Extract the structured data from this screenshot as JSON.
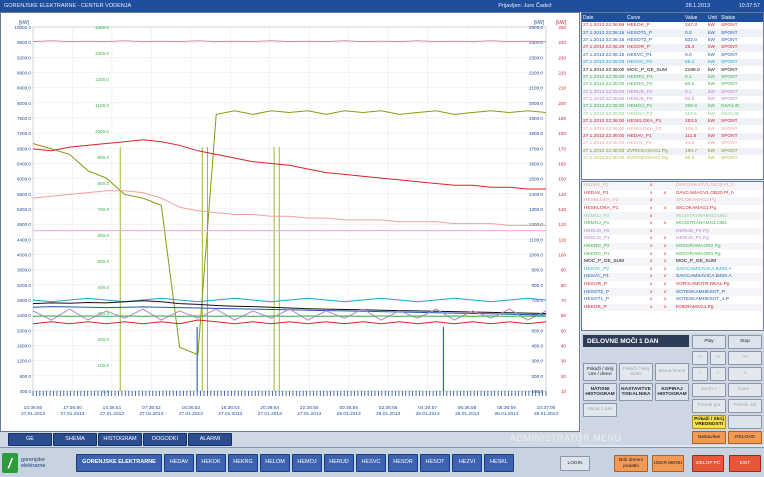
{
  "titlebar": {
    "app": "GORENJSKE ELEKTRARNE - CENTER VODENJA",
    "user": "Prijavljen: Jure Čadež",
    "date": "28.1.2013",
    "time": "10:37:57"
  },
  "chart_data": {
    "type": "line",
    "left_axis_unit": "[kW]",
    "right_axis_units": [
      "[kW]",
      "[kW]"
    ],
    "left_axis_ticks": [
      "10000.0",
      "9600.0",
      "9200.0",
      "8800.0",
      "8400.0",
      "8000.0",
      "7600.0",
      "7200.0",
      "6800.0",
      "6400.0",
      "6000.0",
      "5600.0",
      "5200.0",
      "4800.0",
      "4400.0",
      "4000.0",
      "3600.0",
      "3200.0",
      "2800.0",
      "2400.0",
      "2000.0",
      "1600.0",
      "1200.0",
      "800.0",
      "400.0"
    ],
    "inner_axis_ticks": [
      "1400.0",
      "1300.0",
      "1200.0",
      "1100.0",
      "1000.0",
      "900.0",
      "800.0",
      "700.0",
      "600.0",
      "500.0",
      "400.0",
      "300.0",
      "200.0",
      "100.0",
      "0.0"
    ],
    "right_axis_ticks": [
      "2500.0",
      "2400.0",
      "2300.0",
      "2200.0",
      "2100.0",
      "2000.0",
      "1900.0",
      "1800.0",
      "1700.0",
      "1600.0",
      "1500.0",
      "1400.0",
      "1300.0",
      "1200.0",
      "1100.0",
      "1000.0",
      "900.0",
      "800.0",
      "700.0",
      "600.0",
      "500.0",
      "400.0",
      "300.0",
      "200.0",
      "100.0"
    ],
    "right_inner_ticks": [
      "250",
      "240",
      "230",
      "220",
      "210",
      "200",
      "190",
      "180",
      "170",
      "160",
      "150",
      "140",
      "130",
      "120",
      "110",
      "100",
      "90",
      "80",
      "70",
      "60",
      "50",
      "40",
      "30",
      "20",
      "10"
    ],
    "x_labels": [
      {
        "time": "10:36:50",
        "date": "27.01.2013"
      },
      {
        "time": "17:36:50",
        "date": "27.01.2013"
      },
      {
        "time": "14:36:51",
        "date": "27.01.2013"
      },
      {
        "time": "07:36:52",
        "date": "27.01.2013"
      },
      {
        "time": "18:36:52",
        "date": "27.01.2013"
      },
      {
        "time": "16:36:53",
        "date": "27.01.2013"
      },
      {
        "time": "20:36:54",
        "date": "27.01.2013"
      },
      {
        "time": "22:35:55",
        "date": "27.01.2013"
      },
      {
        "time": "00:36:55",
        "date": "28.01.2013"
      },
      {
        "time": "02:36:56",
        "date": "28.01.2013"
      },
      {
        "time": "04:36:57",
        "date": "28.01.2013"
      },
      {
        "time": "06:36:58",
        "date": "28.01.2013"
      },
      {
        "time": "08:36:59",
        "date": "28.01.2013"
      },
      {
        "time": "10:37:00",
        "date": "28.01.2013"
      }
    ],
    "series": [
      {
        "color": "#8a9a12",
        "values": [
          6800,
          6650,
          6500,
          6050,
          5850,
          5400,
          5300,
          5100,
          1200,
          1000,
          7600,
          7700,
          7600,
          7700,
          7650,
          7700,
          7600,
          7700,
          7650,
          7700,
          7600,
          7650,
          7700,
          7600,
          7650,
          7700,
          7650,
          7700,
          7650
        ]
      },
      {
        "color": "#d8232a",
        "values": [
          6650,
          6600,
          6700,
          6750,
          6800,
          6850,
          6900,
          6850,
          6750,
          6600,
          6500,
          6400,
          6300,
          6250,
          6200,
          6100,
          6000,
          5950,
          5900,
          5850,
          5800,
          5750,
          5700,
          5650,
          5650,
          5600,
          5600,
          5550,
          5550
        ]
      },
      {
        "color": "#f0a0a0",
        "values": [
          5300,
          5350,
          5400,
          5450,
          5500,
          5500,
          5450,
          5300,
          5050,
          4950,
          4900,
          4850,
          4850,
          4800,
          4800,
          4750,
          4750,
          4700,
          4700,
          4700,
          4650,
          4650,
          4650,
          4600,
          4600,
          4600,
          4550,
          4550,
          4550
        ]
      },
      {
        "color": "#d8232a",
        "values": [
          1850,
          1900,
          1850,
          1900,
          1850,
          1900,
          1850,
          1900,
          1850,
          1950,
          1900,
          1850,
          1900,
          1850,
          1900,
          1850,
          1900,
          1850,
          1900,
          1850,
          1900,
          1850,
          1900,
          1850,
          1900,
          1850,
          1900,
          1850,
          1900
        ]
      },
      {
        "color": "#1aa8d8",
        "values": [
          2500,
          2450,
          2500,
          2550,
          2500,
          2450,
          2500,
          2550,
          2500,
          2450,
          2500,
          2550,
          2500,
          2450,
          2500,
          2550,
          2500,
          2450,
          2500,
          2550,
          2500,
          2450,
          2500,
          2550,
          2500,
          2450,
          2500,
          2550,
          2500
        ]
      },
      {
        "color": "#111111",
        "values": [
          2400,
          2420,
          2410,
          2430,
          2420,
          2450,
          2480,
          2450,
          2400,
          2380,
          2350,
          2330,
          2320,
          2300,
          2280,
          2260,
          2250,
          2240,
          2230,
          2220,
          2210,
          2200,
          2190,
          2180,
          2170,
          2160,
          2150,
          2140,
          2130
        ]
      },
      {
        "color": "#1e5ab4",
        "values": [
          2300,
          2320,
          2310,
          2300,
          2290,
          2300,
          2310,
          2300,
          2290,
          2280,
          2270,
          2260,
          2250,
          2240,
          2230,
          2220,
          2210,
          2200,
          2190,
          2180,
          2170,
          2160,
          2150,
          2140,
          2130,
          2120,
          2110,
          2100,
          2090
        ]
      },
      {
        "color": "#c080d0",
        "values": [
          2200,
          1950,
          2250,
          1950,
          2200,
          2000,
          2250,
          1950,
          2200,
          2000,
          2250,
          1950,
          2200,
          2000,
          2250,
          1950,
          2200,
          2000,
          2250,
          1950,
          2200,
          2000,
          2250,
          1950,
          2200,
          2000,
          2250,
          1950,
          2200
        ]
      },
      {
        "color": "#3ab34a",
        "values": [
          2050,
          2060,
          2050,
          2060,
          2050,
          2060,
          2050,
          2060,
          2050,
          2060,
          2050,
          2060,
          2050,
          2060,
          2050,
          2060,
          2050,
          2060,
          2050,
          2060,
          2050,
          2060,
          2050,
          2060,
          2050,
          2060,
          2050,
          2060,
          2050
        ]
      },
      {
        "color": "#d090a0",
        "values": [
          9600,
          9620,
          9600,
          9610,
          9600,
          9620,
          9600,
          9610,
          9600,
          9620,
          9600,
          9610,
          9600,
          9620,
          9600,
          9610,
          9600,
          9620,
          9600,
          9610,
          9600,
          9620,
          9600,
          9610,
          9600,
          9620,
          9600,
          9610,
          9600
        ]
      },
      {
        "color": "#f4a6d8",
        "values": [
          4400,
          4410,
          4400,
          4410,
          4400,
          4410,
          4400,
          4410,
          4400,
          4410,
          4400,
          4410,
          4400,
          4410,
          4400,
          4410,
          4400,
          4410,
          4400,
          4410,
          4400,
          4410,
          4400,
          4410,
          4400,
          4410,
          4400,
          4410,
          4400
        ]
      }
    ],
    "ylim": [
      0,
      10000
    ]
  },
  "cursor_table": {
    "headers": [
      "Date",
      "Curve",
      "Value",
      "Unit",
      "Status"
    ],
    "rows": [
      {
        "date": "27.1.2013 22:36:59",
        "curve": "HEKOK_P",
        "value": "247.3",
        "unit": "kW",
        "status": "SPONT",
        "color": "#d8232a"
      },
      {
        "date": "27.1.2013 22:36:15",
        "curve": "HESOT1_P",
        "value": "0.0",
        "unit": "kW",
        "status": "SPONT",
        "color": "#1e5ab4"
      },
      {
        "date": "27.1.2013 22:36:15",
        "curve": "HESOT2_P",
        "value": "832.0",
        "unit": "kW",
        "status": "SPONT",
        "color": "#1e5ab4"
      },
      {
        "date": "27.1.2013 22:36:29",
        "curve": "HESOR_P",
        "value": "26.3",
        "unit": "kW",
        "status": "SPONT",
        "color": "#d8232a"
      },
      {
        "date": "27.1.2013 22:36:16",
        "curve": "HESVC_P1",
        "value": "0.0",
        "unit": "kW",
        "status": "SPONT",
        "color": "#1e5ab4"
      },
      {
        "date": "27.1.2013 22:36:03",
        "curve": "HESVC_P2",
        "value": "65.1",
        "unit": "kW",
        "status": "SPONT",
        "color": "#1aa8d8"
      },
      {
        "date": "27.1.2013 22:36:00",
        "curve": "MOC_P_GE_SUM",
        "value": "2198.0",
        "unit": "kW",
        "status": "SPONT",
        "color": "#111111"
      },
      {
        "date": "27.1.2013 22:36:00",
        "curve": "HEKRG_P1",
        "value": "0.1",
        "unit": "kW",
        "status": "SPONT",
        "color": "#3ab34a"
      },
      {
        "date": "27.1.2013 22:36:00",
        "curve": "HEKRG_P2",
        "value": "83.2",
        "unit": "kW",
        "status": "SPONT",
        "color": "#3ab34a"
      },
      {
        "date": "27.1.2013 22:36:00",
        "curve": "HERUD_P1",
        "value": "0.1",
        "unit": "kW",
        "status": "SPONT",
        "color": "#c080d0"
      },
      {
        "date": "27.1.2013 22:36:00",
        "curve": "HERUD_P2",
        "value": "82.5",
        "unit": "kW",
        "status": "SPONT",
        "color": "#c080d0"
      },
      {
        "date": "27.1.2013 22:36:00",
        "curve": "HEMOJ_P1",
        "value": "209.6",
        "unit": "kW",
        "status": "INVALID",
        "color": "#3ab34a"
      },
      {
        "date": "27.1.2013 22:36:00",
        "curve": "HEMOJ_P2",
        "value": "119.6",
        "unit": "kW",
        "status": "INVALID",
        "color": "#8ed08e"
      },
      {
        "date": "27.1.2013 22:36:00",
        "curve": "HESKLOKA_P1",
        "value": "193.5",
        "unit": "kW",
        "status": "SPONT",
        "color": "#d8232a"
      },
      {
        "date": "27.1.2013 22:36:00",
        "curve": "HESKLOKA_P2",
        "value": "105.3",
        "unit": "kW",
        "status": "SPONT",
        "color": "#f0a0a0"
      },
      {
        "date": "27.1.2013 22:36:00",
        "curve": "HEDAV_P1",
        "value": "111.5",
        "unit": "kW",
        "status": "SPONT",
        "color": "#d8232a"
      },
      {
        "date": "27.1.2013 22:36:00",
        "curve": "HEDAV_P2",
        "value": "43.6",
        "unit": "kW",
        "status": "SPONT",
        "color": "#f0a0a0"
      },
      {
        "date": "27.1.2013 22:36:00",
        "curve": "ZVIRCEVSAG1.Pg",
        "value": "190.7",
        "unit": "kW",
        "status": "SPONT",
        "color": "#8a9a12"
      },
      {
        "date": "27.1.2013 22:36:00",
        "curve": "ZVIRCEVSAG1.Pg",
        "value": "86.9",
        "unit": "kW",
        "status": "SPONT",
        "color": "#b8c040"
      }
    ]
  },
  "signal_list": [
    {
      "name": "HEDAV_P2",
      "m1": "x",
      "m2": "",
      "tag": "DAVCAMAGV1.OB20.Pf_h",
      "color": "#f0a0a0"
    },
    {
      "name": "HEDAV_P1",
      "m1": "x",
      "m2": "x",
      "tag": "DAVCAMAGV1.OB20.Pf_h",
      "color": "#d8232a"
    },
    {
      "name": "HESKLOKA_P2",
      "m1": "x",
      "m2": "",
      "tag": "SKLOKAMAG2.Pg",
      "color": "#f0a0a0"
    },
    {
      "name": "HESKLOKA_P1",
      "m1": "x",
      "m2": "x",
      "tag": "SKLOKAMAG1.Pg",
      "color": "#d8232a"
    },
    {
      "name": "HEMOJ_P2",
      "m1": "x",
      "m2": "",
      "tag": "MOJSTRANAMG2.OB2",
      "color": "#8ed08e"
    },
    {
      "name": "HEMOJ_P1",
      "m1": "x",
      "m2": "x",
      "tag": "MOJSTRANAMG1.OB2",
      "color": "#3ab34a"
    },
    {
      "name": "HERUD_P2",
      "m1": "x",
      "m2": "",
      "tag": "HERUD_P2.Pg",
      "color": "#c080d0"
    },
    {
      "name": "HERUD_P1",
      "m1": "x",
      "m2": "x",
      "tag": "HERUD_P1.Pg",
      "color": "#c080d0"
    },
    {
      "name": "HEKRG_P2",
      "m1": "x",
      "m2": "x",
      "tag": "KRSGRAMAGR2.Pg",
      "color": "#3ab34a"
    },
    {
      "name": "HEKRG_P1",
      "m1": "x",
      "m2": "x",
      "tag": "KRSGRAMAGR1.Pg",
      "color": "#3ab34a"
    },
    {
      "name": "MOC_P_GE_SUM",
      "m1": "x",
      "m2": "x",
      "tag": "MOC_P_GE_SUM",
      "color": "#111111"
    },
    {
      "name": "HESVC_P2",
      "m1": "x",
      "m2": "x",
      "tag": "SAVICAMSAVICA.B400.A",
      "color": "#1aa8d8"
    },
    {
      "name": "HESVC_P1",
      "m1": "x",
      "m2": "x",
      "tag": "SAVICAMSAVICA.B400.A",
      "color": "#1e5ab4"
    },
    {
      "name": "HESOR_P",
      "m1": "x",
      "m2": "x",
      "tag": "SORICAMOTR.REAL.Pg",
      "color": "#d8232a"
    },
    {
      "name": "HESOT2_P",
      "m1": "x",
      "m2": "x",
      "tag": "SOTESKAMHESOT_P",
      "color": "#1e5ab4"
    },
    {
      "name": "HESOT1_P",
      "m1": "x",
      "m2": "x",
      "tag": "SOTESKAMHESOT_1.P",
      "color": "#1e5ab4"
    },
    {
      "name": "HEKOK_P",
      "m1": "x",
      "m2": "x",
      "tag": "KOKRAMAG1.Pg",
      "color": "#d8232a"
    }
  ],
  "controls": {
    "title": "DELOVNE MOČI 1 DAN",
    "play": "Play",
    "stop": "Stop",
    "prikazi_ure_dnev": "Prikaži / skrij Ure / dnevi",
    "prikazi_ure_skalo": "Prikaži / skrij Skalo",
    "barva_dnev": "Barva Dnevi",
    "natisni_histogram": "NATISNI HISTOGRAM",
    "nastavitve_tiskalnika": "NASTAVITVE TISKALNIKA",
    "kopiraj_histogram": "KOPIRAJ HISTOGRAM",
    "nazaj": "Nazaj 1 dan",
    "prikazi_vrednosti": "Prikaži / Skrij VREDNOSTI",
    "nastavitve": "Nastavitve",
    "reload": "RELOAD",
    "nav_back2": "<<",
    "nav_fwd2": ">>",
    "nav_back": "<",
    "nav_fwd": ">",
    "zoom_in": "zoom +",
    "zoom_out": "zoom -",
    "shift_up": "Premik gor",
    "shift_down": "Premik dol"
  },
  "tabs": [
    "GE",
    "SHEMA",
    "HISTOGRAM",
    "DOGODKI",
    "ALARMI"
  ],
  "admin_menu": "ADMINISTRATOR MENU",
  "footer": {
    "logo_top": "gorenjske",
    "logo_bottom": "elektrarne",
    "company": "GORENJSKE ELEKTRARNE",
    "plants": [
      "HEDAV",
      "HEKOK",
      "HEKRG",
      "HELOM",
      "HEMOJ",
      "HERUD",
      "HESVC",
      "HESOR",
      "HESOT",
      "HEZVI",
      "HESKL"
    ],
    "login": "LOGIN",
    "user_menu": "USER MENU",
    "bild_dnevni": "Brik dnevni podatki",
    "izklop": "IZKLOP PC",
    "exit": "EXIT"
  },
  "colors": {
    "primary": "#1f4e9c",
    "accent_yellow": "#f7e14a",
    "accent_orange": "#f29a55",
    "alert_red": "#e8563a"
  }
}
